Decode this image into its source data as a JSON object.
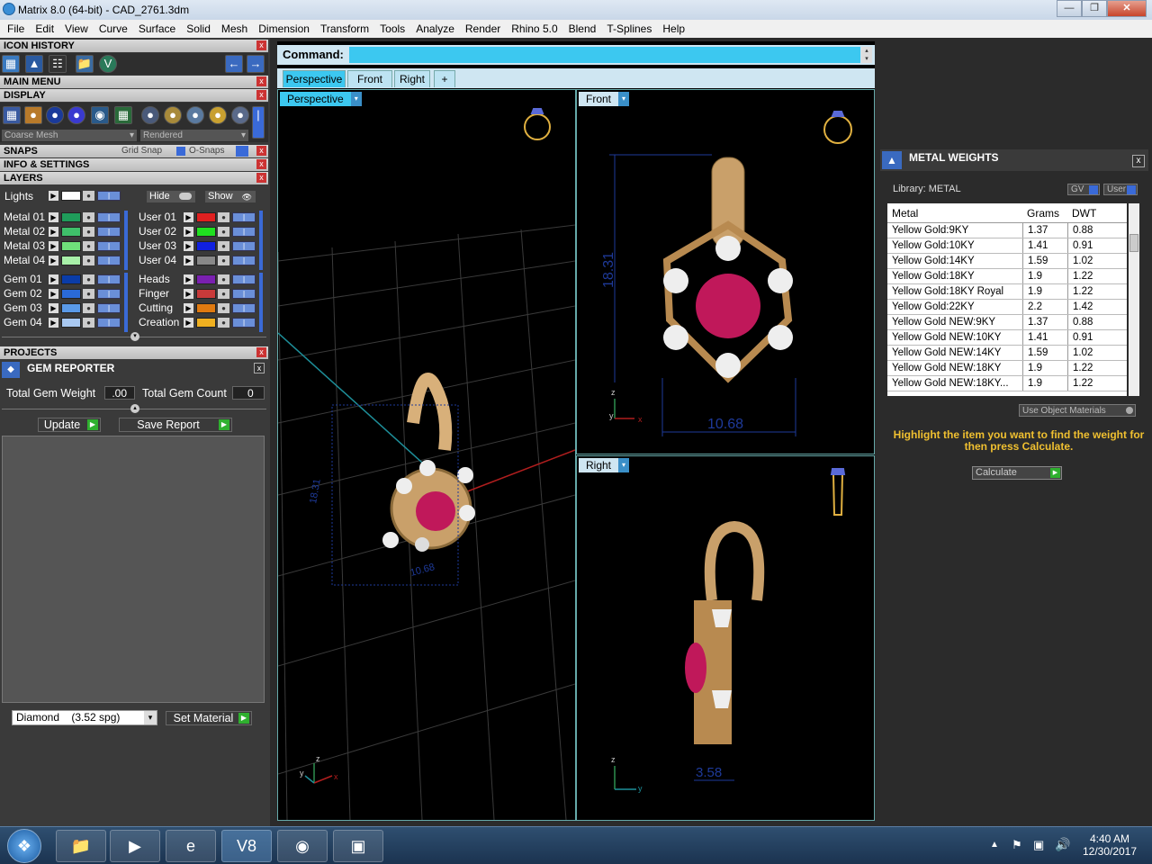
{
  "window": {
    "title": "Matrix 8.0 (64-bit) - CAD_2761.3dm"
  },
  "menu": [
    "File",
    "Edit",
    "View",
    "Curve",
    "Surface",
    "Solid",
    "Mesh",
    "Dimension",
    "Transform",
    "Tools",
    "Analyze",
    "Render",
    "Rhino 5.0",
    "Blend",
    "T-Splines",
    "Help"
  ],
  "left": {
    "icon_history": "ICON HISTORY",
    "main_menu": "MAIN MENU",
    "display": "DISPLAY",
    "coarse_mesh": "Coarse Mesh",
    "rendered": "Rendered",
    "snaps": "SNAPS",
    "grid_snap": "Grid Snap",
    "o_snaps": "O-Snaps",
    "info_settings": "INFO & SETTINGS",
    "layers": "LAYERS",
    "lights": "Lights",
    "hide": "Hide",
    "show": "Show",
    "left_layers": [
      "Metal 01",
      "Metal 02",
      "Metal 03",
      "Metal 04",
      "Gem 01",
      "Gem 02",
      "Gem 03",
      "Gem 04"
    ],
    "right_layers": [
      "User 01",
      "User 02",
      "User 03",
      "User 04",
      "Heads",
      "Finger",
      "Cutting",
      "Creation"
    ],
    "left_colors": [
      "#1f9c5a",
      "#3fc06a",
      "#6fe07a",
      "#a8f0a8",
      "#0a3ca8",
      "#2a6ad8",
      "#5a9ae8",
      "#a8c8f0"
    ],
    "right_colors": [
      "#e02020",
      "#20e020",
      "#1020e0",
      "#888888",
      "#7a20b0",
      "#c83a3a",
      "#e07a10",
      "#f0b020"
    ],
    "projects": "PROJECTS",
    "gem_reporter": "GEM REPORTER",
    "total_gem_weight": "Total Gem Weight",
    "gem_weight_value": ".00",
    "total_gem_count": "Total Gem Count",
    "gem_count_value": "0",
    "update": "Update",
    "save_report": "Save Report",
    "material_select": "Diamond    (3.52 spg)",
    "set_material": "Set Material"
  },
  "center": {
    "command_label": "Command:",
    "tabs": [
      "Perspective",
      "Front",
      "Right",
      "+"
    ],
    "vp_perspective": "Perspective",
    "vp_front": "Front",
    "vp_right": "Right",
    "dim_front_height": "18.31",
    "dim_front_width": "10.68",
    "dim_right_width": "3.58"
  },
  "right": {
    "title": "METAL WEIGHTS",
    "library": "Library: METAL",
    "gv": "GV",
    "user": "User",
    "headers": [
      "Metal",
      "Grams",
      "DWT"
    ],
    "rows": [
      [
        "Yellow Gold:9KY",
        "1.37",
        "0.88"
      ],
      [
        "Yellow Gold:10KY",
        "1.41",
        "0.91"
      ],
      [
        "Yellow Gold:14KY",
        "1.59",
        "1.02"
      ],
      [
        "Yellow Gold:18KY",
        "1.9",
        "1.22"
      ],
      [
        "Yellow Gold:18KY Royal",
        "1.9",
        "1.22"
      ],
      [
        "Yellow Gold:22KY",
        "2.2",
        "1.42"
      ],
      [
        "Yellow Gold NEW:9KY",
        "1.37",
        "0.88"
      ],
      [
        "Yellow Gold NEW:10KY",
        "1.41",
        "0.91"
      ],
      [
        "Yellow Gold NEW:14KY",
        "1.59",
        "1.02"
      ],
      [
        "Yellow Gold NEW:18KY",
        "1.9",
        "1.22"
      ],
      [
        "Yellow Gold NEW:18KY...",
        "1.9",
        "1.22"
      ]
    ],
    "use_object_materials": "Use Object Materials",
    "hint": "Highlight the item you want to find the weight for then press Calculate.",
    "calculate": "Calculate"
  },
  "taskbar": {
    "time": "4:40 AM",
    "date": "12/30/2017"
  }
}
